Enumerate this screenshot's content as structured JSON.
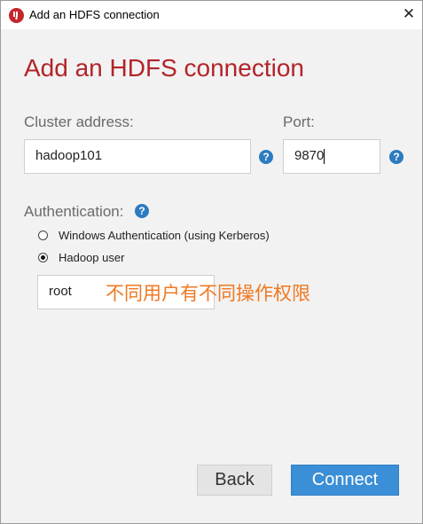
{
  "window": {
    "title": "Add an HDFS connection",
    "close_glyph": "✕"
  },
  "page": {
    "heading": "Add an HDFS connection"
  },
  "cluster": {
    "label": "Cluster address:",
    "value": "hadoop101"
  },
  "port": {
    "label": "Port:",
    "value": "9870"
  },
  "help_glyph": "?",
  "auth": {
    "label": "Authentication:",
    "options": [
      {
        "label": "Windows Authentication (using Kerberos)",
        "selected": false
      },
      {
        "label": "Hadoop user",
        "selected": true
      }
    ],
    "user_value": "root"
  },
  "annotation": {
    "text": "不同用户有不同操作权限",
    "color": "#f07822"
  },
  "buttons": {
    "back": "Back",
    "connect": "Connect"
  },
  "colors": {
    "heading": "#b2242a",
    "accent": "#3a8fd6",
    "help": "#2c7bc0"
  }
}
